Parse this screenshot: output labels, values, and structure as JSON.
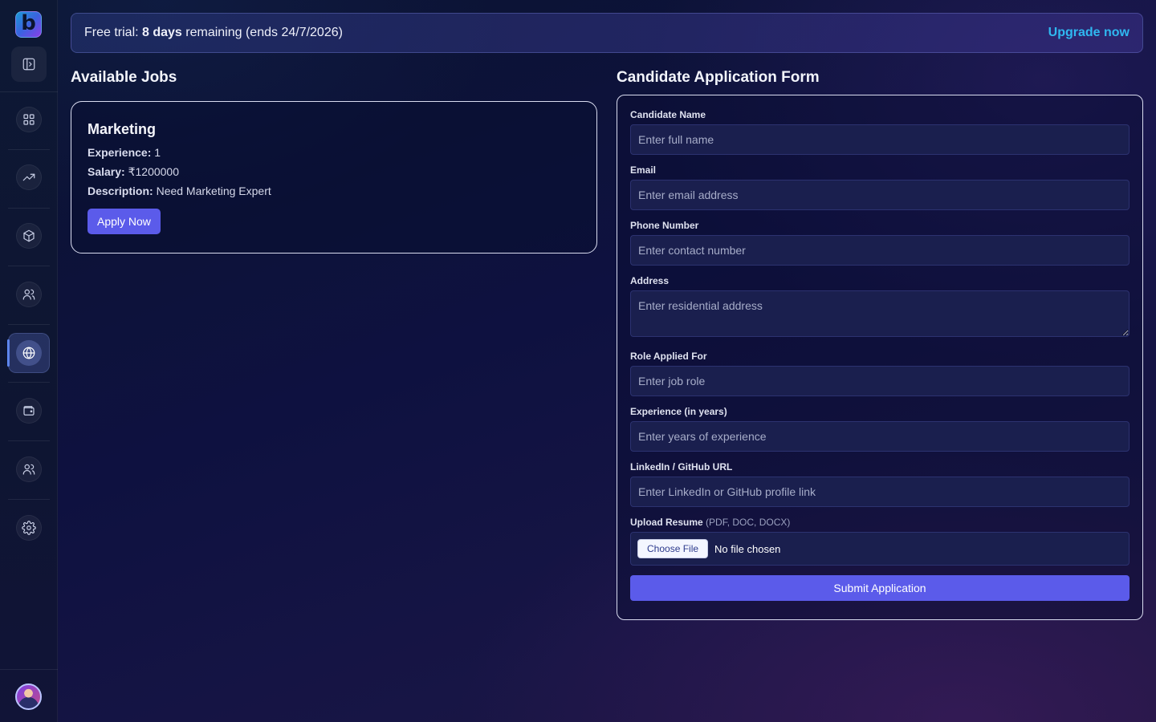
{
  "sidebar": {
    "logo_letter": "b",
    "nav_items": [
      {
        "icon": "dashboard-grid-icon"
      },
      {
        "icon": "trending-up-icon"
      },
      {
        "icon": "package-box-icon"
      },
      {
        "icon": "users-icon"
      },
      {
        "icon": "globe-icon",
        "active": true
      },
      {
        "icon": "wallet-icon"
      },
      {
        "icon": "team-users-icon"
      },
      {
        "icon": "settings-gear-icon"
      }
    ]
  },
  "banner": {
    "prefix": "Free trial: ",
    "days": "8 days",
    "suffix": " remaining (ends 24/7/2026)",
    "upgrade_label": "Upgrade now"
  },
  "jobs": {
    "title": "Available Jobs",
    "items": [
      {
        "title": "Marketing",
        "experience_label": "Experience:",
        "experience": " 1",
        "salary_label": "Salary:",
        "salary": " ₹1200000",
        "description_label": "Description:",
        "description": " Need Marketing Expert",
        "apply_label": "Apply Now"
      }
    ]
  },
  "form": {
    "title": "Candidate Application Form",
    "name": {
      "label": "Candidate Name",
      "placeholder": "Enter full name"
    },
    "email": {
      "label": "Email",
      "placeholder": "Enter email address"
    },
    "phone": {
      "label": "Phone Number",
      "placeholder": "Enter contact number"
    },
    "address": {
      "label": "Address",
      "placeholder": "Enter residential address"
    },
    "role": {
      "label": "Role Applied For",
      "placeholder": "Enter job role"
    },
    "experience": {
      "label": "Experience (in years)",
      "placeholder": "Enter years of experience"
    },
    "profile": {
      "label": "LinkedIn / GitHub URL",
      "placeholder": "Enter LinkedIn or GitHub profile link"
    },
    "resume": {
      "label": "Upload Resume",
      "hint": " (PDF, DOC, DOCX)",
      "choose_label": "Choose File",
      "status": "No file chosen"
    },
    "submit_label": "Submit Application"
  }
}
